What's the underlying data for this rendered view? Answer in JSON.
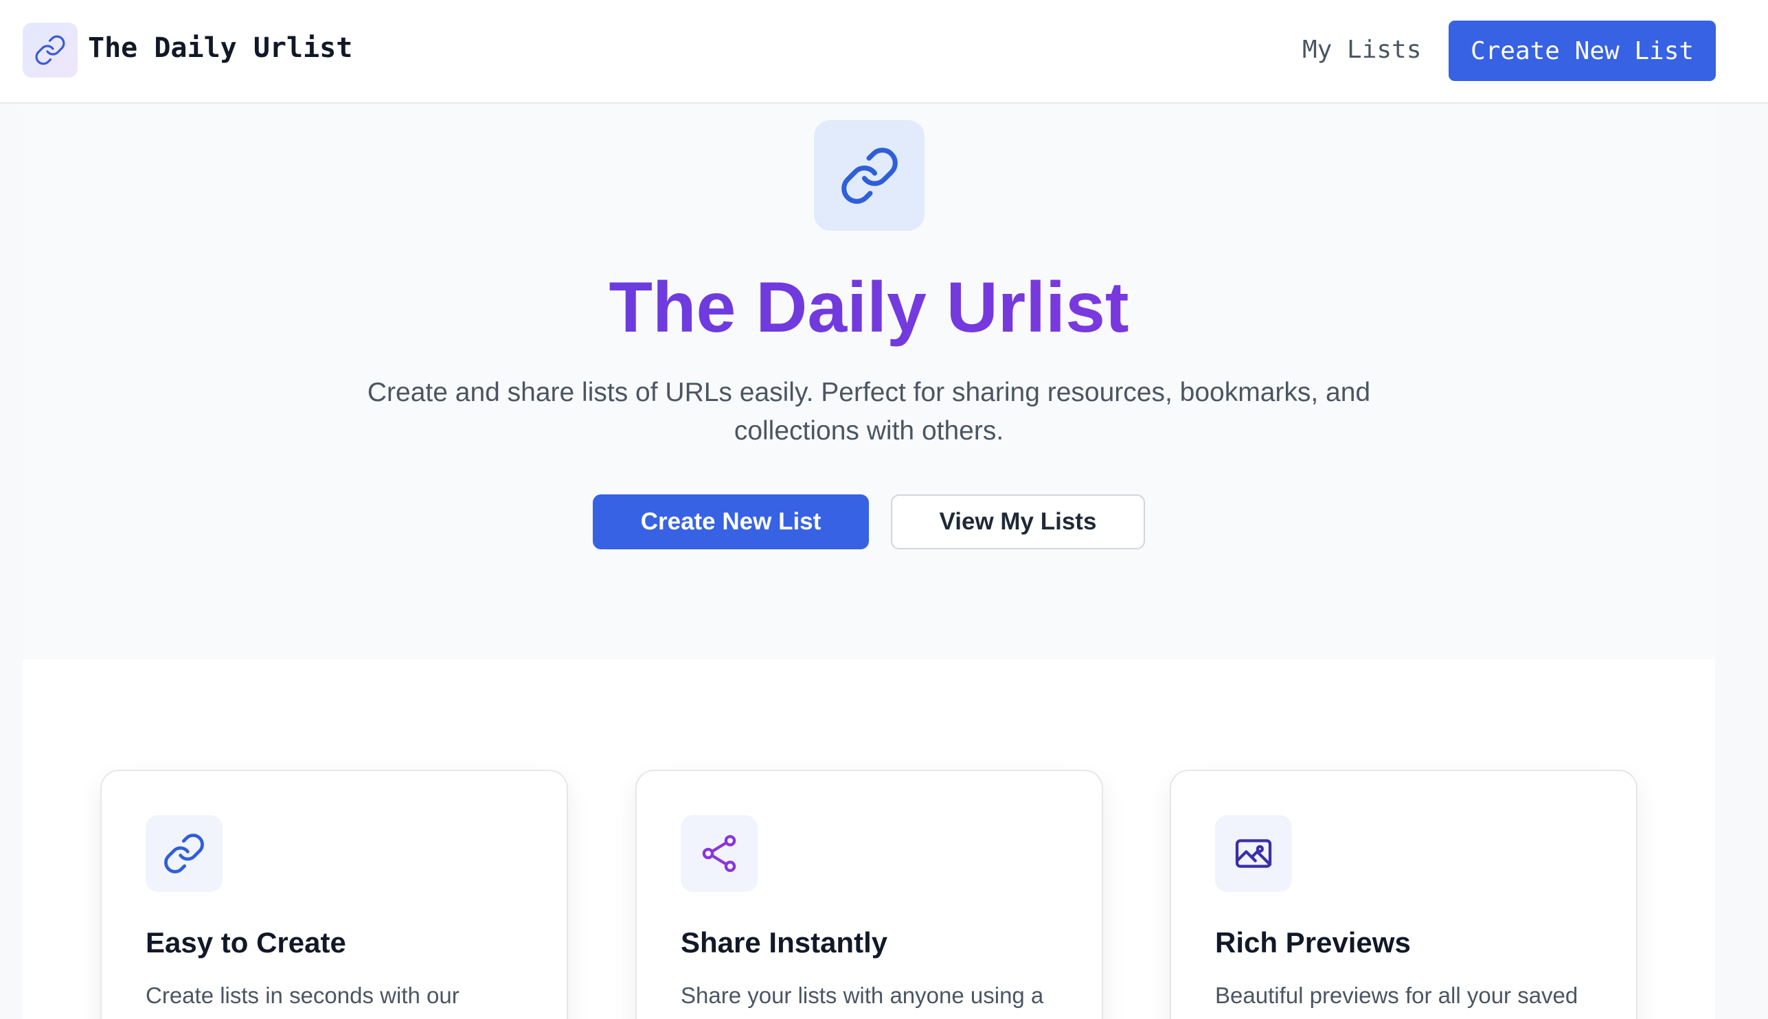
{
  "header": {
    "brand_name": "The Daily Urlist",
    "logo_icon": "link-icon",
    "nav_my_lists": "My Lists",
    "nav_create": "Create New List"
  },
  "hero": {
    "icon": "link-icon",
    "title": "The Daily Urlist",
    "subtitle": "Create and share lists of URLs easily. Perfect for sharing resources, bookmarks, and collections with others.",
    "primary_button": "Create New List",
    "secondary_button": "View My Lists"
  },
  "features": [
    {
      "icon": "link-icon",
      "title": "Easy to Create",
      "description": "Create lists in seconds with our"
    },
    {
      "icon": "share-icon",
      "title": "Share Instantly",
      "description": "Share your lists with anyone using a"
    },
    {
      "icon": "image-icon",
      "title": "Rich Previews",
      "description": "Beautiful previews for all your saved"
    }
  ],
  "colors": {
    "primary": "#3762e4",
    "title_gradient_start": "#5b3fe0",
    "title_gradient_end": "#8a35dc",
    "share_accent": "#8a35dc",
    "image_accent": "#3b2fa8"
  }
}
